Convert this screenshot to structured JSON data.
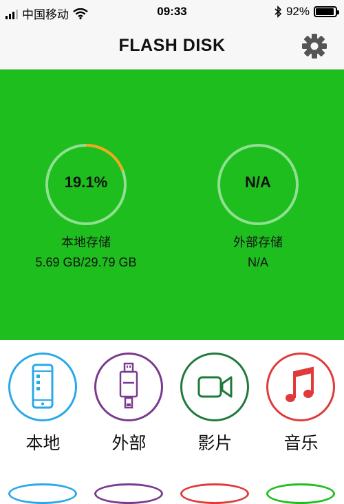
{
  "status_bar": {
    "carrier": "中国移动",
    "time": "09:33",
    "battery_percent": "92%",
    "battery_level": 0.92,
    "icons": [
      "signal-icon",
      "wifi-icon",
      "bluetooth-icon",
      "battery-icon"
    ]
  },
  "navbar": {
    "title": "FLASH DISK",
    "settings_icon": "gear-icon"
  },
  "storage": {
    "local": {
      "percent_text": "19.1%",
      "percent_value": 19.1,
      "label": "本地存储",
      "size": "5.69 GB/29.79 GB"
    },
    "external": {
      "percent_text": "N/A",
      "label": "外部存储",
      "size": "N/A"
    }
  },
  "colors": {
    "hero_bg": "#1fbe1f",
    "ring_track": "#8fe08f",
    "ring_progress": "#f0a81c",
    "local": "#29a9e8",
    "external": "#7a3a8e",
    "video": "#1f7a3a",
    "music": "#e03a3a"
  },
  "tiles": [
    {
      "label": "本地",
      "icon": "phone-icon",
      "color": "#29a9e8"
    },
    {
      "label": "外部",
      "icon": "usb-drive-icon",
      "color": "#7a3a8e"
    },
    {
      "label": "影片",
      "icon": "video-camera-icon",
      "color": "#1f7a3a"
    },
    {
      "label": "音乐",
      "icon": "music-note-icon",
      "color": "#e03a3a"
    }
  ]
}
